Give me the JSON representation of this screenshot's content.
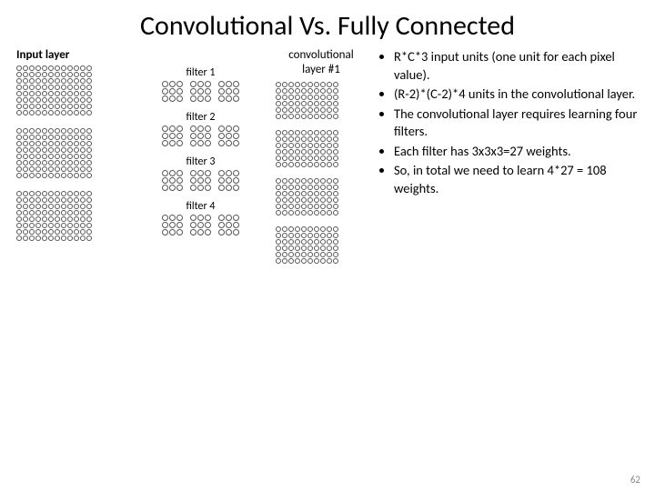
{
  "title": "Convolutional Vs. Fully Connected",
  "input_label": "Input layer",
  "conv_label_line1": "convolutional",
  "conv_label_line2": "layer #1",
  "filters": [
    {
      "label": "filter 1"
    },
    {
      "label": "filter 2"
    },
    {
      "label": "filter 3"
    },
    {
      "label": "filter 4"
    }
  ],
  "bullets": [
    "R*C*3 input units (one unit for each pixel value).",
    "(R-2)*(C-2)*4 units in the convolutional layer.",
    "The convolutional layer requires learning four filters.",
    "Each filter has 3x3x3=27 weights.",
    "So, in total we need to learn 4*27 = 108 weights."
  ],
  "input_rows": 8,
  "input_cols": 12,
  "input_channels": 3,
  "conv_rows": 6,
  "conv_cols": 10,
  "conv_channels": 4,
  "filter_rows": 3,
  "filter_cols": 3,
  "filter_depth": 3,
  "page_number": "62"
}
